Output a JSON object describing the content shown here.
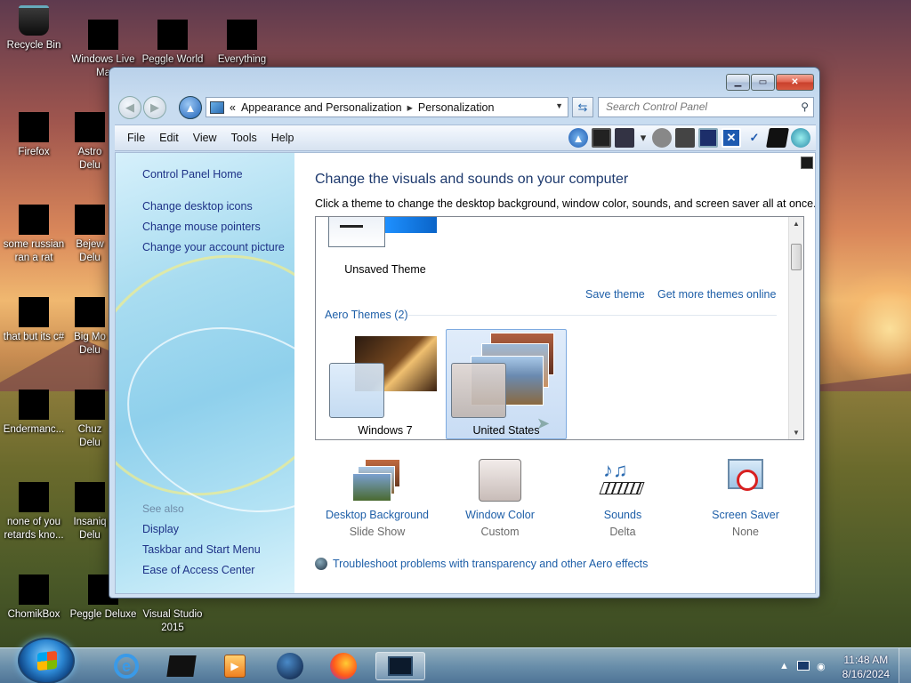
{
  "desktop": {
    "icons": [
      {
        "label": "Recycle Bin",
        "icon": "recycle-bin-icon"
      },
      {
        "label": "Windows Live Ma",
        "icon": "windows-live-icon"
      },
      {
        "label": "Peggle World",
        "icon": "peggle-world-icon"
      },
      {
        "label": "Everything",
        "icon": "everything-icon"
      },
      {
        "label": "Firefox",
        "icon": "firefox-icon"
      },
      {
        "label": "Astro Delu",
        "icon": "astro-deluxe-icon"
      },
      {
        "label": "some russian ran a rat",
        "icon": "app-icon"
      },
      {
        "label": "Bejew Delu",
        "icon": "bejeweled-icon"
      },
      {
        "label": "that but its c#",
        "icon": "folder-icon"
      },
      {
        "label": "Big Mo Delu",
        "icon": "big-money-icon"
      },
      {
        "label": "Endermanc...",
        "icon": "app-icon"
      },
      {
        "label": "Chuz Delu",
        "icon": "chuzzle-icon"
      },
      {
        "label": "none of you retards kno...",
        "icon": "app-icon"
      },
      {
        "label": "Insaniq Delu",
        "icon": "insaniquarium-icon"
      },
      {
        "label": "ChomikBox",
        "icon": "chomikbox-icon"
      },
      {
        "label": "Peggle Deluxe",
        "icon": "peggle-deluxe-icon"
      },
      {
        "label": "Visual Studio 2015",
        "icon": "visual-studio-icon"
      }
    ]
  },
  "window": {
    "breadcrumb": {
      "chevron": "«",
      "items": [
        "Appearance and Personalization",
        "Personalization"
      ],
      "separator": "▸"
    },
    "search_placeholder": "Search Control Panel",
    "menu": [
      "File",
      "Edit",
      "View",
      "Tools",
      "Help"
    ],
    "left_pane": {
      "home": "Control Panel Home",
      "links": [
        "Change desktop icons",
        "Change mouse pointers",
        "Change your account picture"
      ],
      "see_also_title": "See also",
      "see_also": [
        "Display",
        "Taskbar and Start Menu",
        "Ease of Access Center"
      ]
    },
    "main": {
      "title": "Change the visuals and sounds on your computer",
      "subtitle": "Click a theme to change the desktop background, window color, sounds, and screen saver all at once.",
      "unsaved_theme_label": "Unsaved Theme",
      "save_theme": "Save theme",
      "get_more_themes": "Get more themes online",
      "aero_group": "Aero Themes (2)",
      "themes": [
        {
          "label": "Windows 7",
          "selected": false
        },
        {
          "label": "United States",
          "selected": true
        }
      ],
      "bottom": [
        {
          "link": "Desktop Background",
          "value": "Slide Show"
        },
        {
          "link": "Window Color",
          "value": "Custom"
        },
        {
          "link": "Sounds",
          "value": "Delta"
        },
        {
          "link": "Screen Saver",
          "value": "None"
        }
      ],
      "troubleshoot": "Troubleshoot problems with transparency and other Aero effects"
    }
  },
  "taskbar": {
    "time": "11:48 AM",
    "date": "8/16/2024",
    "apps": [
      "internet-explorer-icon",
      "media-icon",
      "player-icon",
      "globe-icon",
      "firefox-icon",
      "personalization-icon"
    ]
  },
  "colors": {
    "link": "#1e5fa8",
    "title": "#1e3a6e",
    "selection": "#c8dcf4"
  }
}
